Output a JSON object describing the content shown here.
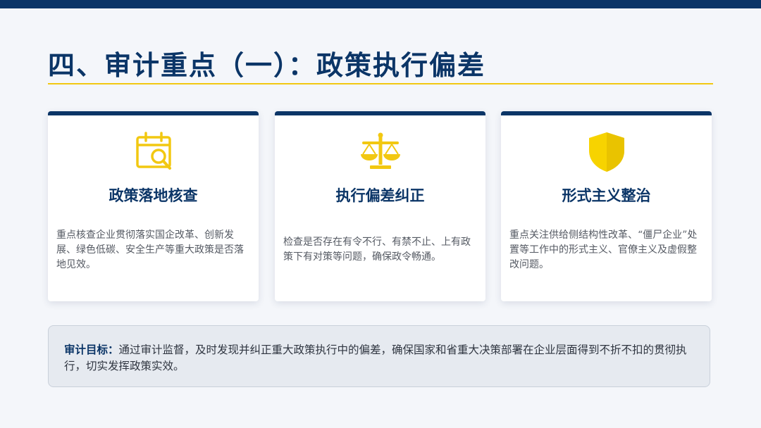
{
  "page": {
    "title": "四、审计重点（一）：政策执行偏差"
  },
  "cards": [
    {
      "icon": "calendar-search-icon",
      "title": "政策落地核查",
      "description": "重点核查企业贯彻落实国企改革、创新发展、绿色低碳、安全生产等重大政策是否落地见效。"
    },
    {
      "icon": "scale-balance-icon",
      "title": "执行偏差纠正",
      "description": "检查是否存在有令不行、有禁不止、上有政策下有对策等问题，确保政令畅通。"
    },
    {
      "icon": "shield-icon",
      "title": "形式主义整治",
      "description": "重点关注供给侧结构性改革、“僵尸企业”处置等工作中的形式主义、官僚主义及虚假整改问题。"
    }
  ],
  "goal": {
    "label": "审计目标：",
    "text": "通过审计监督，及时发现并纠正重大政策执行中的偏差，确保国家和省重大决策部署在企业层面得到不折不扣的贯彻执行，切实发挥政策实效。"
  },
  "colors": {
    "primary": "#0b3567",
    "accent": "#f2c811",
    "card_background": "#ffffff",
    "goal_background": "#e6eaf0"
  }
}
